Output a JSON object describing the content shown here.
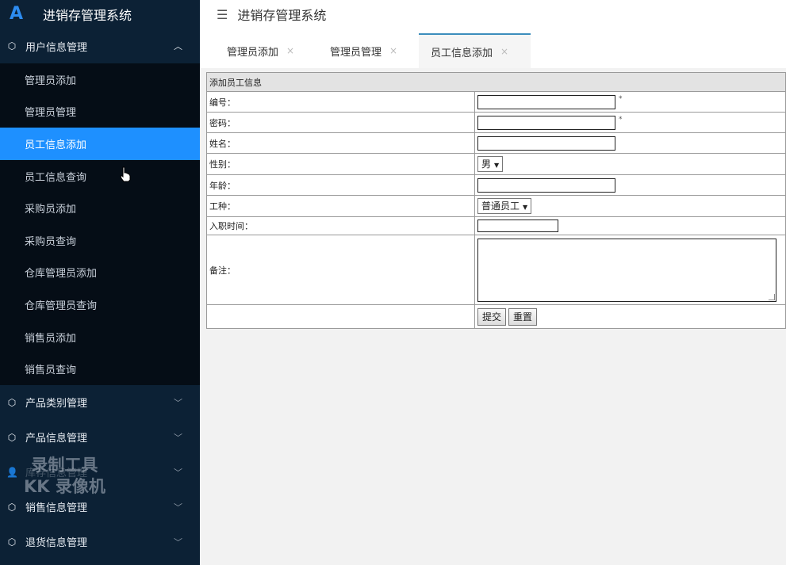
{
  "app": {
    "title": "进销存管理系统"
  },
  "sidebar": {
    "groups": [
      {
        "label": "用户信息管理",
        "open": true,
        "items": [
          "管理员添加",
          "管理员管理",
          "员工信息添加",
          "员工信息查询",
          "采购员添加",
          "采购员查询",
          "仓库管理员添加",
          "仓库管理员查询",
          "销售员添加",
          "销售员查询"
        ],
        "active": "员工信息添加"
      },
      {
        "label": "产品类别管理"
      },
      {
        "label": "产品信息管理"
      },
      {
        "label": "库存信息管理"
      },
      {
        "label": "销售信息管理"
      },
      {
        "label": "退货信息管理"
      }
    ]
  },
  "watermark": {
    "line1": "录制工具",
    "line2": "KK 录像机"
  },
  "topbar": {
    "title": "进销存管理系统"
  },
  "tabs": [
    {
      "label": "管理员添加",
      "close": "×"
    },
    {
      "label": "管理员管理",
      "close": "×"
    },
    {
      "label": "员工信息添加",
      "close": "×",
      "active": true
    }
  ],
  "form": {
    "heading": "添加员工信息",
    "fields": {
      "id": {
        "label": "编号：",
        "required": "*"
      },
      "password": {
        "label": "密码：",
        "required": "*"
      },
      "name": {
        "label": "姓名："
      },
      "gender": {
        "label": "性别：",
        "value": "男"
      },
      "age": {
        "label": "年龄："
      },
      "job_type": {
        "label": "工种：",
        "value": "普通员工"
      },
      "hire_date": {
        "label": "入职时间："
      },
      "remark": {
        "label": "备注："
      }
    },
    "buttons": {
      "submit": "提交",
      "reset": "重置"
    }
  },
  "colors": {
    "sidebar_bg": "#0c2135",
    "active_item": "#1e90ff",
    "tab_accent": "#3c8dbc"
  }
}
